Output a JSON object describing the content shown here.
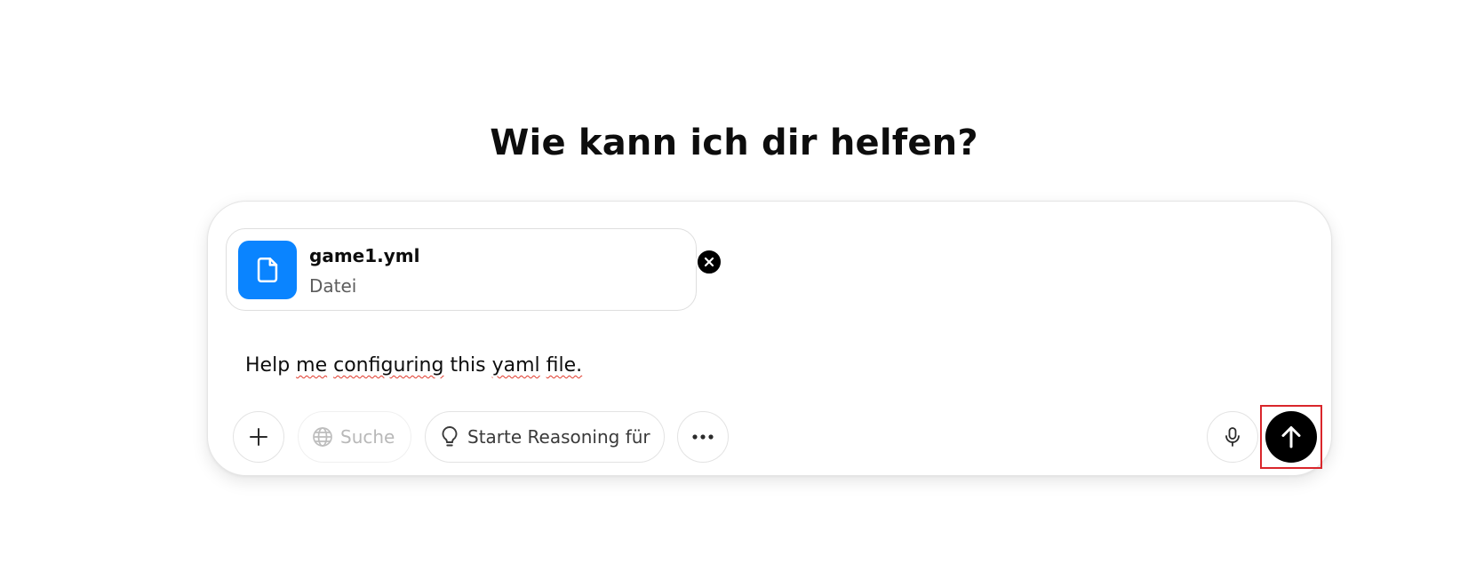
{
  "heading": "Wie kann ich dir helfen?",
  "attachment": {
    "file_name": "game1.yml",
    "file_type": "Datei",
    "icon": "document-icon",
    "remove_icon": "close-icon"
  },
  "prompt": {
    "words": [
      "Help",
      "me",
      "configuring",
      "this",
      "yaml",
      "file."
    ],
    "misspelled": [
      "me",
      "configuring",
      "yaml",
      "file."
    ]
  },
  "toolbar": {
    "add_icon": "plus-icon",
    "search_label": "Suche",
    "search_icon": "globe-icon",
    "reasoning_label": "Starte Reasoning für",
    "reasoning_icon": "lightbulb-icon",
    "more_icon": "ellipsis-icon",
    "mic_icon": "microphone-icon",
    "send_icon": "arrow-up-icon"
  },
  "colors": {
    "file_tile": "#0a84ff",
    "send_button": "#000000",
    "highlight": "#d9262b",
    "spellcheck": "#e0392b"
  }
}
